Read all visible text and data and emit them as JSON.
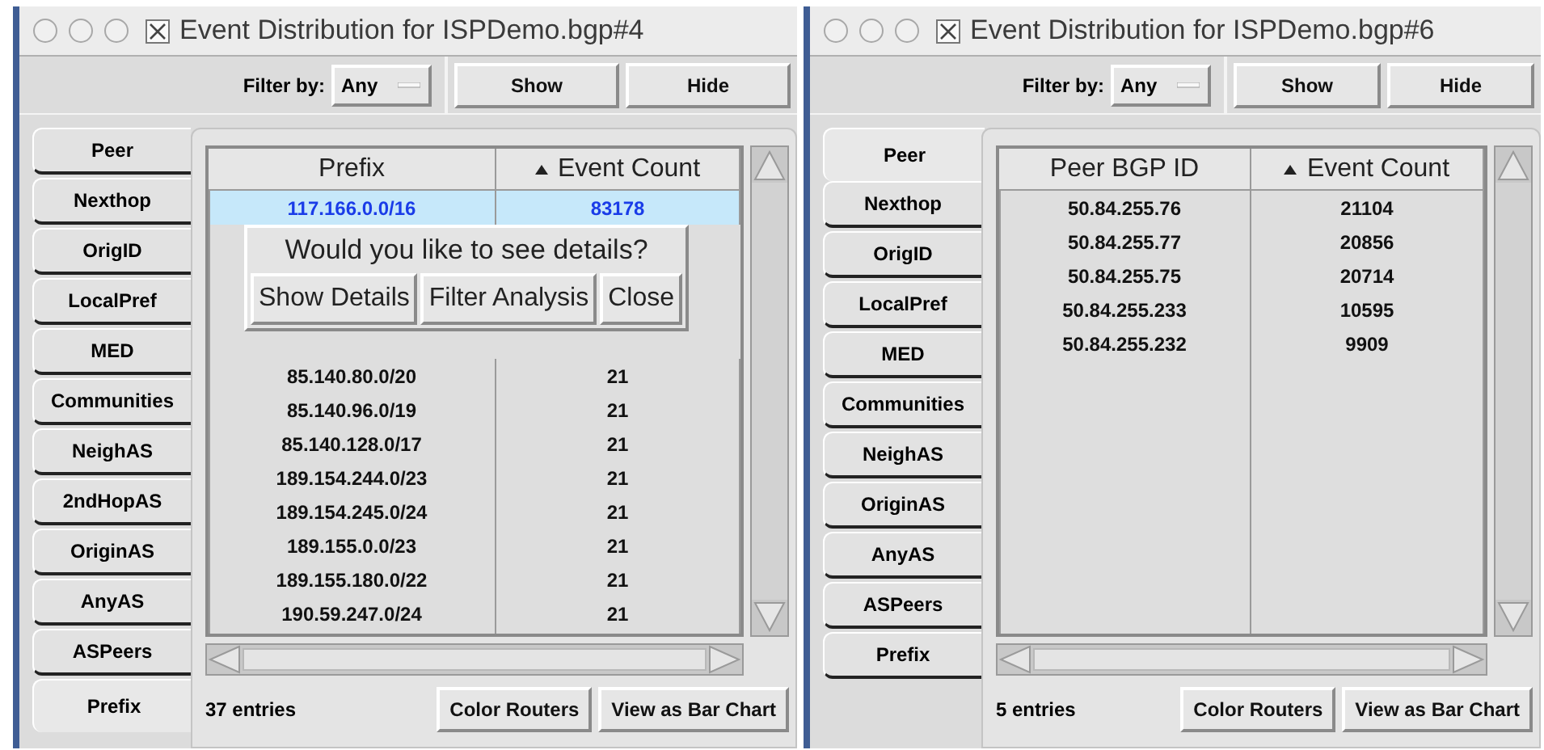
{
  "windows": [
    {
      "title": "Event Distribution for ISPDemo.bgp#4",
      "filter": {
        "label": "Filter by:",
        "value": "Any"
      },
      "buttons": [
        "Show",
        "Hide"
      ],
      "tabs": [
        {
          "label": "Peer",
          "selected": false
        },
        {
          "label": "Nexthop",
          "selected": false
        },
        {
          "label": "OrigID",
          "selected": false
        },
        {
          "label": "LocalPref",
          "selected": false
        },
        {
          "label": "MED",
          "selected": false
        },
        {
          "label": "Communities",
          "selected": false
        },
        {
          "label": "NeighAS",
          "selected": false
        },
        {
          "label": "2ndHopAS",
          "selected": false
        },
        {
          "label": "OriginAS",
          "selected": false
        },
        {
          "label": "AnyAS",
          "selected": false
        },
        {
          "label": "ASPeers",
          "selected": false
        },
        {
          "label": "Prefix",
          "selected": true
        }
      ],
      "table": {
        "columns": [
          {
            "label": "Prefix",
            "sorted": false
          },
          {
            "label": "Event Count",
            "sorted": true
          }
        ],
        "rows": [
          {
            "cells": [
              "117.166.0.0/16",
              "83178"
            ],
            "selected": true
          },
          {
            "cells": [
              "85.140.80.0/20",
              "21"
            ],
            "selected": false
          },
          {
            "cells": [
              "85.140.96.0/19",
              "21"
            ],
            "selected": false
          },
          {
            "cells": [
              "85.140.128.0/17",
              "21"
            ],
            "selected": false
          },
          {
            "cells": [
              "189.154.244.0/23",
              "21"
            ],
            "selected": false
          },
          {
            "cells": [
              "189.154.245.0/24",
              "21"
            ],
            "selected": false
          },
          {
            "cells": [
              "189.155.0.0/23",
              "21"
            ],
            "selected": false
          },
          {
            "cells": [
              "189.155.180.0/22",
              "21"
            ],
            "selected": false
          },
          {
            "cells": [
              "190.59.247.0/24",
              "21"
            ],
            "selected": false
          }
        ]
      },
      "popup": {
        "message": "Would you like to see details?",
        "buttons": [
          "Show Details",
          "Filter Analysis",
          "Close"
        ]
      },
      "entries": "37 entries",
      "footer_buttons": [
        "Color Routers",
        "View as Bar Chart"
      ]
    },
    {
      "title": "Event Distribution for ISPDemo.bgp#6",
      "filter": {
        "label": "Filter by:",
        "value": "Any"
      },
      "buttons": [
        "Show",
        "Hide"
      ],
      "tabs": [
        {
          "label": "Peer",
          "selected": true
        },
        {
          "label": "Nexthop",
          "selected": false
        },
        {
          "label": "OrigID",
          "selected": false
        },
        {
          "label": "LocalPref",
          "selected": false
        },
        {
          "label": "MED",
          "selected": false
        },
        {
          "label": "Communities",
          "selected": false
        },
        {
          "label": "NeighAS",
          "selected": false
        },
        {
          "label": "OriginAS",
          "selected": false
        },
        {
          "label": "AnyAS",
          "selected": false
        },
        {
          "label": "ASPeers",
          "selected": false
        },
        {
          "label": "Prefix",
          "selected": false
        }
      ],
      "table": {
        "columns": [
          {
            "label": "Peer BGP ID",
            "sorted": false
          },
          {
            "label": "Event Count",
            "sorted": true
          }
        ],
        "rows": [
          {
            "cells": [
              "50.84.255.76",
              "21104"
            ],
            "selected": false
          },
          {
            "cells": [
              "50.84.255.77",
              "20856"
            ],
            "selected": false
          },
          {
            "cells": [
              "50.84.255.75",
              "20714"
            ],
            "selected": false
          },
          {
            "cells": [
              "50.84.255.233",
              "10595"
            ],
            "selected": false
          },
          {
            "cells": [
              "50.84.255.232",
              "9909"
            ],
            "selected": false
          }
        ]
      },
      "entries": "5 entries",
      "footer_buttons": [
        "Color Routers",
        "View as Bar Chart"
      ]
    }
  ]
}
